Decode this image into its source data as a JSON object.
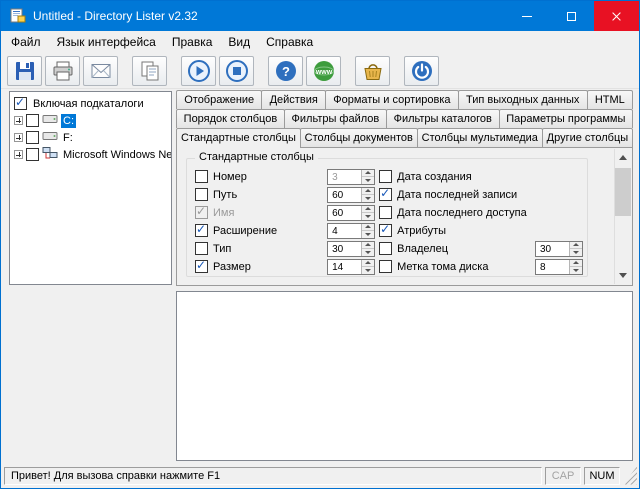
{
  "colors": {
    "titlebar": "#0078d7",
    "close_button": "#e81123",
    "selection": "#0078d7",
    "window_background": "#f0f0f0"
  },
  "window": {
    "title": "Untitled - Directory Lister v2.32"
  },
  "menu": {
    "items": [
      "Файл",
      "Язык интерфейса",
      "Правка",
      "Вид",
      "Справка"
    ]
  },
  "toolbar": {
    "buttons": [
      {
        "name": "save",
        "icon": "save-icon"
      },
      {
        "name": "print",
        "icon": "print-icon"
      },
      {
        "name": "email",
        "icon": "email-icon"
      },
      {
        "name": "copy",
        "icon": "copy-icon"
      },
      {
        "name": "generate",
        "icon": "play-icon"
      },
      {
        "name": "stop",
        "icon": "stop-icon"
      },
      {
        "name": "help",
        "icon": "help-icon"
      },
      {
        "name": "website",
        "icon": "globe-icon"
      },
      {
        "name": "donate",
        "icon": "basket-icon"
      },
      {
        "name": "exit",
        "icon": "power-icon"
      }
    ]
  },
  "tree": {
    "include_subdirectories": {
      "label": "Включая подкаталоги",
      "checked": true
    },
    "items": [
      {
        "label": "C:",
        "type": "drive",
        "selected": true,
        "checked": false
      },
      {
        "label": "F:",
        "type": "drive",
        "selected": false,
        "checked": false
      },
      {
        "label": "Microsoft Windows Network",
        "type": "network",
        "selected": false,
        "checked": false
      }
    ]
  },
  "tabs": {
    "rows": [
      [
        "Отображение",
        "Действия",
        "Форматы и сортировка",
        "Тип выходных данных",
        "HTML"
      ],
      [
        "Порядок столбцов",
        "Фильтры файлов",
        "Фильтры каталогов",
        "Параметры программы"
      ],
      [
        "Стандартные столбцы",
        "Столбцы документов",
        "Столбцы мультимедиа",
        "Другие столбцы"
      ]
    ],
    "active": "Стандартные столбцы"
  },
  "options": {
    "group_title": "Стандартные столбцы",
    "left": [
      {
        "label": "Номер",
        "checked": false,
        "value": "3",
        "value_enabled": false
      },
      {
        "label": "Путь",
        "checked": false,
        "value": "60",
        "value_enabled": true
      },
      {
        "label": "Имя",
        "checked": true,
        "checkbox_disabled": true,
        "value": "60",
        "value_enabled": true
      },
      {
        "label": "Расширение",
        "checked": true,
        "value": "4",
        "value_enabled": true
      },
      {
        "label": "Тип",
        "checked": false,
        "value": "30",
        "value_enabled": true
      },
      {
        "label": "Размер",
        "checked": true,
        "value": "14",
        "value_enabled": true
      }
    ],
    "right": [
      {
        "label": "Дата создания",
        "checked": false
      },
      {
        "label": "Дата последней записи",
        "checked": true
      },
      {
        "label": "Дата последнего доступа",
        "checked": false
      },
      {
        "label": "Атрибуты",
        "checked": true
      },
      {
        "label": "Владелец",
        "checked": false,
        "value": "30",
        "value_enabled": true
      },
      {
        "label": "Метка тома диска",
        "checked": false,
        "value": "8",
        "value_enabled": true
      }
    ]
  },
  "statusbar": {
    "message": "Привет! Для вызова справки нажмите F1",
    "indicators": [
      {
        "label": "CAP",
        "active": false
      },
      {
        "label": "NUM",
        "active": true
      }
    ]
  }
}
